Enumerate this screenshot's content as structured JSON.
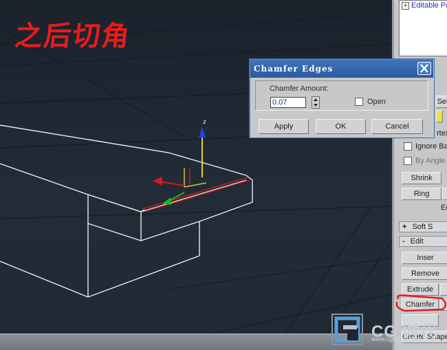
{
  "annotation": {
    "title": "之后切角"
  },
  "dialog": {
    "title": "Chamfer Edges",
    "amount_label": "Chamfer Amount:",
    "amount_value": "0.07",
    "open_label": "Open",
    "apply_label": "Apply",
    "ok_label": "OK",
    "cancel_label": "Cancel"
  },
  "panel": {
    "stack_item": "Editable Po",
    "sel_label": "Sel",
    "vertex_fragment": "rtex",
    "ignore_backfacing": "Ignore Ba",
    "by_angle": "By Angle",
    "shrink_label": "Shrink",
    "ring_label": "Ring",
    "edit_fragment": "Ec",
    "soft_selection": "Soft S",
    "edit_edges": "Edit",
    "insert_label": "Inser",
    "remove_label": "Remove",
    "extrude_label": "Extrude",
    "chamfer_label": "Chamfer",
    "create_shape": "Create Shape",
    "rollout_plus": "+",
    "rollout_minus": "-"
  },
  "gizmo": {
    "z_axis_label": "z"
  },
  "watermark": {
    "brand": "CG 时代",
    "url": "www.cgtimes.com"
  },
  "colors": {
    "annotation_red": "#e81c1c",
    "viewport_bg": "#1d2630",
    "dialog_title_bar": "#2c5a9e",
    "panel_bg": "#c5c7c9",
    "edge_white": "#e8ecef",
    "selected_edge": "#d21a1a"
  }
}
